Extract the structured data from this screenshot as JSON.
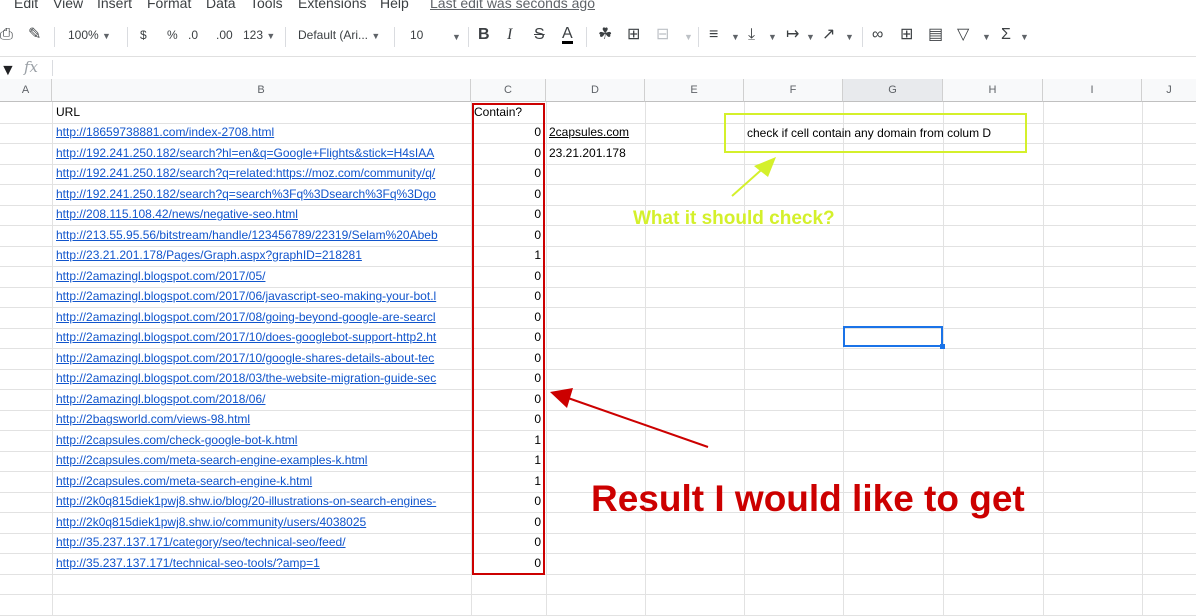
{
  "menu": {
    "items": [
      "Edit",
      "View",
      "Insert",
      "Format",
      "Data",
      "Tools",
      "Extensions",
      "Help"
    ],
    "last_edit": "Last edit was seconds ago"
  },
  "toolbar": {
    "zoom": "100%",
    "currency": "$",
    "percent": "%",
    "decrease_decimal": ".0",
    "increase_decimal": ".00",
    "more_formats": "123",
    "font": "Default (Ari...",
    "font_size": "10",
    "bold": "B",
    "italic": "I",
    "strikethrough": "S",
    "text_color": "A",
    "functions": "Σ"
  },
  "formula_bar": {
    "fx": "fx",
    "value": ""
  },
  "columns": [
    "A",
    "B",
    "C",
    "D",
    "E",
    "F",
    "G",
    "H",
    "I",
    "J"
  ],
  "selected_column": "G",
  "header_row": {
    "url": "URL",
    "contain": "Contain?"
  },
  "rows": [
    {
      "url": "http://18659738881.com/index-2708.html",
      "contain": "0",
      "domain": "2capsules.com"
    },
    {
      "url": "http://192.241.250.182/search?hl=en&q=Google+Flights&stick=H4sIAA",
      "contain": "0",
      "domain": "23.21.201.178"
    },
    {
      "url": "http://192.241.250.182/search?q=related:https://moz.com/community/q/",
      "contain": "0",
      "domain": ""
    },
    {
      "url": "http://192.241.250.182/search?q=search%3Fq%3Dsearch%3Fq%3Dgo",
      "contain": "0",
      "domain": ""
    },
    {
      "url": "http://208.115.108.42/news/negative-seo.html",
      "contain": "0",
      "domain": ""
    },
    {
      "url": "http://213.55.95.56/bitstream/handle/123456789/22319/Selam%20Abeb",
      "contain": "0",
      "domain": ""
    },
    {
      "url": "http://23.21.201.178/Pages/Graph.aspx?graphID=218281",
      "contain": "1",
      "domain": ""
    },
    {
      "url": "http://2amazingl.blogspot.com/2017/05/",
      "contain": "0",
      "domain": ""
    },
    {
      "url": "http://2amazingl.blogspot.com/2017/06/javascript-seo-making-your-bot.l",
      "contain": "0",
      "domain": ""
    },
    {
      "url": "http://2amazingl.blogspot.com/2017/08/going-beyond-google-are-searcl",
      "contain": "0",
      "domain": ""
    },
    {
      "url": "http://2amazingl.blogspot.com/2017/10/does-googlebot-support-http2.ht",
      "contain": "0",
      "domain": ""
    },
    {
      "url": "http://2amazingl.blogspot.com/2017/10/google-shares-details-about-tec",
      "contain": "0",
      "domain": ""
    },
    {
      "url": "http://2amazingl.blogspot.com/2018/03/the-website-migration-guide-sec",
      "contain": "0",
      "domain": ""
    },
    {
      "url": "http://2amazingl.blogspot.com/2018/06/",
      "contain": "0",
      "domain": ""
    },
    {
      "url": "http://2bagsworld.com/views-98.html",
      "contain": "0",
      "domain": ""
    },
    {
      "url": "http://2capsules.com/check-google-bot-k.html",
      "contain": "1",
      "domain": ""
    },
    {
      "url": "http://2capsules.com/meta-search-engine-examples-k.html",
      "contain": "1",
      "domain": ""
    },
    {
      "url": "http://2capsules.com/meta-search-engine-k.html",
      "contain": "1",
      "domain": ""
    },
    {
      "url": "http://2k0q815diek1pwj8.shw.io/blog/20-illustrations-on-search-engines-",
      "contain": "0",
      "domain": ""
    },
    {
      "url": "http://2k0q815diek1pwj8.shw.io/community/users/4038025",
      "contain": "0",
      "domain": ""
    },
    {
      "url": "http://35.237.137.171/category/seo/technical-seo/feed/",
      "contain": "0",
      "domain": ""
    },
    {
      "url": "http://35.237.137.171/technical-seo-tools/?amp=1",
      "contain": "0",
      "domain": ""
    }
  ],
  "annotations": {
    "note_box": "check if cell contain any domain from colum D",
    "question": "What it should check?",
    "result": "Result I would like to get",
    "green": "#d4f02b",
    "red": "#cc0000"
  }
}
